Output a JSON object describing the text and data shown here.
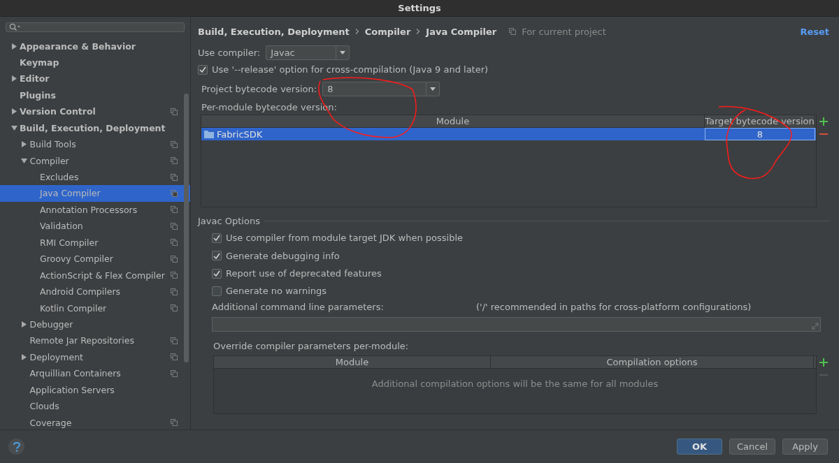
{
  "window": {
    "title": "Settings"
  },
  "sidebar": {
    "items": [
      {
        "label": "Appearance & Behavior",
        "expanded": false,
        "selected": false,
        "project_scope": false
      },
      {
        "label": "Keymap",
        "selected": false,
        "project_scope": false
      },
      {
        "label": "Editor",
        "expanded": false,
        "selected": false,
        "project_scope": false
      },
      {
        "label": "Plugins",
        "selected": false,
        "project_scope": false
      },
      {
        "label": "Version Control",
        "expanded": false,
        "selected": false,
        "project_scope": true
      },
      {
        "label": "Build, Execution, Deployment",
        "expanded": true,
        "selected": false,
        "project_scope": false,
        "children": [
          {
            "label": "Build Tools",
            "expanded": false,
            "selected": false,
            "project_scope": true
          },
          {
            "label": "Compiler",
            "expanded": true,
            "selected": false,
            "project_scope": true,
            "children": [
              {
                "label": "Excludes",
                "selected": false,
                "project_scope": true
              },
              {
                "label": "Java Compiler",
                "selected": true,
                "project_scope": true
              },
              {
                "label": "Annotation Processors",
                "selected": false,
                "project_scope": true
              },
              {
                "label": "Validation",
                "selected": false,
                "project_scope": true
              },
              {
                "label": "RMI Compiler",
                "selected": false,
                "project_scope": true
              },
              {
                "label": "Groovy Compiler",
                "selected": false,
                "project_scope": true
              },
              {
                "label": "ActionScript & Flex Compiler",
                "selected": false,
                "project_scope": true
              },
              {
                "label": "Android Compilers",
                "selected": false,
                "project_scope": true
              },
              {
                "label": "Kotlin Compiler",
                "selected": false,
                "project_scope": true
              }
            ]
          },
          {
            "label": "Debugger",
            "expanded": false,
            "selected": false,
            "project_scope": false
          },
          {
            "label": "Remote Jar Repositories",
            "selected": false,
            "project_scope": true
          },
          {
            "label": "Deployment",
            "expanded": false,
            "selected": false,
            "project_scope": true
          },
          {
            "label": "Arquillian Containers",
            "selected": false,
            "project_scope": true
          },
          {
            "label": "Application Servers",
            "selected": false,
            "project_scope": false
          },
          {
            "label": "Clouds",
            "selected": false,
            "project_scope": false
          },
          {
            "label": "Coverage",
            "selected": false,
            "project_scope": true
          }
        ]
      }
    ]
  },
  "breadcrumb": [
    "Build, Execution, Deployment",
    "Compiler",
    "Java Compiler"
  ],
  "scope_note": "For current project",
  "reset_link": "Reset",
  "use_compiler": {
    "label": "Use compiler:",
    "value": "Javac"
  },
  "release_option": {
    "label": "Use '--release' option for cross-compilation (Java 9 and later)",
    "checked": true
  },
  "project_bytecode": {
    "label": "Project bytecode version:",
    "value": "8"
  },
  "per_module": {
    "label": "Per-module bytecode version:",
    "columns": [
      "Module",
      "Target bytecode version"
    ],
    "remove_enabled": true,
    "rows": [
      {
        "module": "FabricSDK",
        "target": "8",
        "selected": true
      }
    ]
  },
  "javac_options": {
    "title": "Javac Options",
    "options": [
      {
        "label": "Use compiler from module target JDK when possible",
        "checked": true
      },
      {
        "label": "Generate debugging info",
        "checked": true
      },
      {
        "label": "Report use of deprecated features",
        "checked": true
      },
      {
        "label": "Generate no warnings",
        "checked": false
      }
    ],
    "additional_params": {
      "label": "Additional command line parameters:",
      "hint": "('/' recommended in paths for cross-platform configurations)"
    }
  },
  "override": {
    "label": "Override compiler parameters per-module:",
    "columns": [
      "Module",
      "Compilation options"
    ],
    "empty_text": "Additional compilation options will be the same for all modules",
    "remove_enabled": false
  },
  "buttons": [
    {
      "label": "OK",
      "default": true
    },
    {
      "label": "Cancel",
      "default": false
    },
    {
      "label": "Apply",
      "default": false
    }
  ]
}
